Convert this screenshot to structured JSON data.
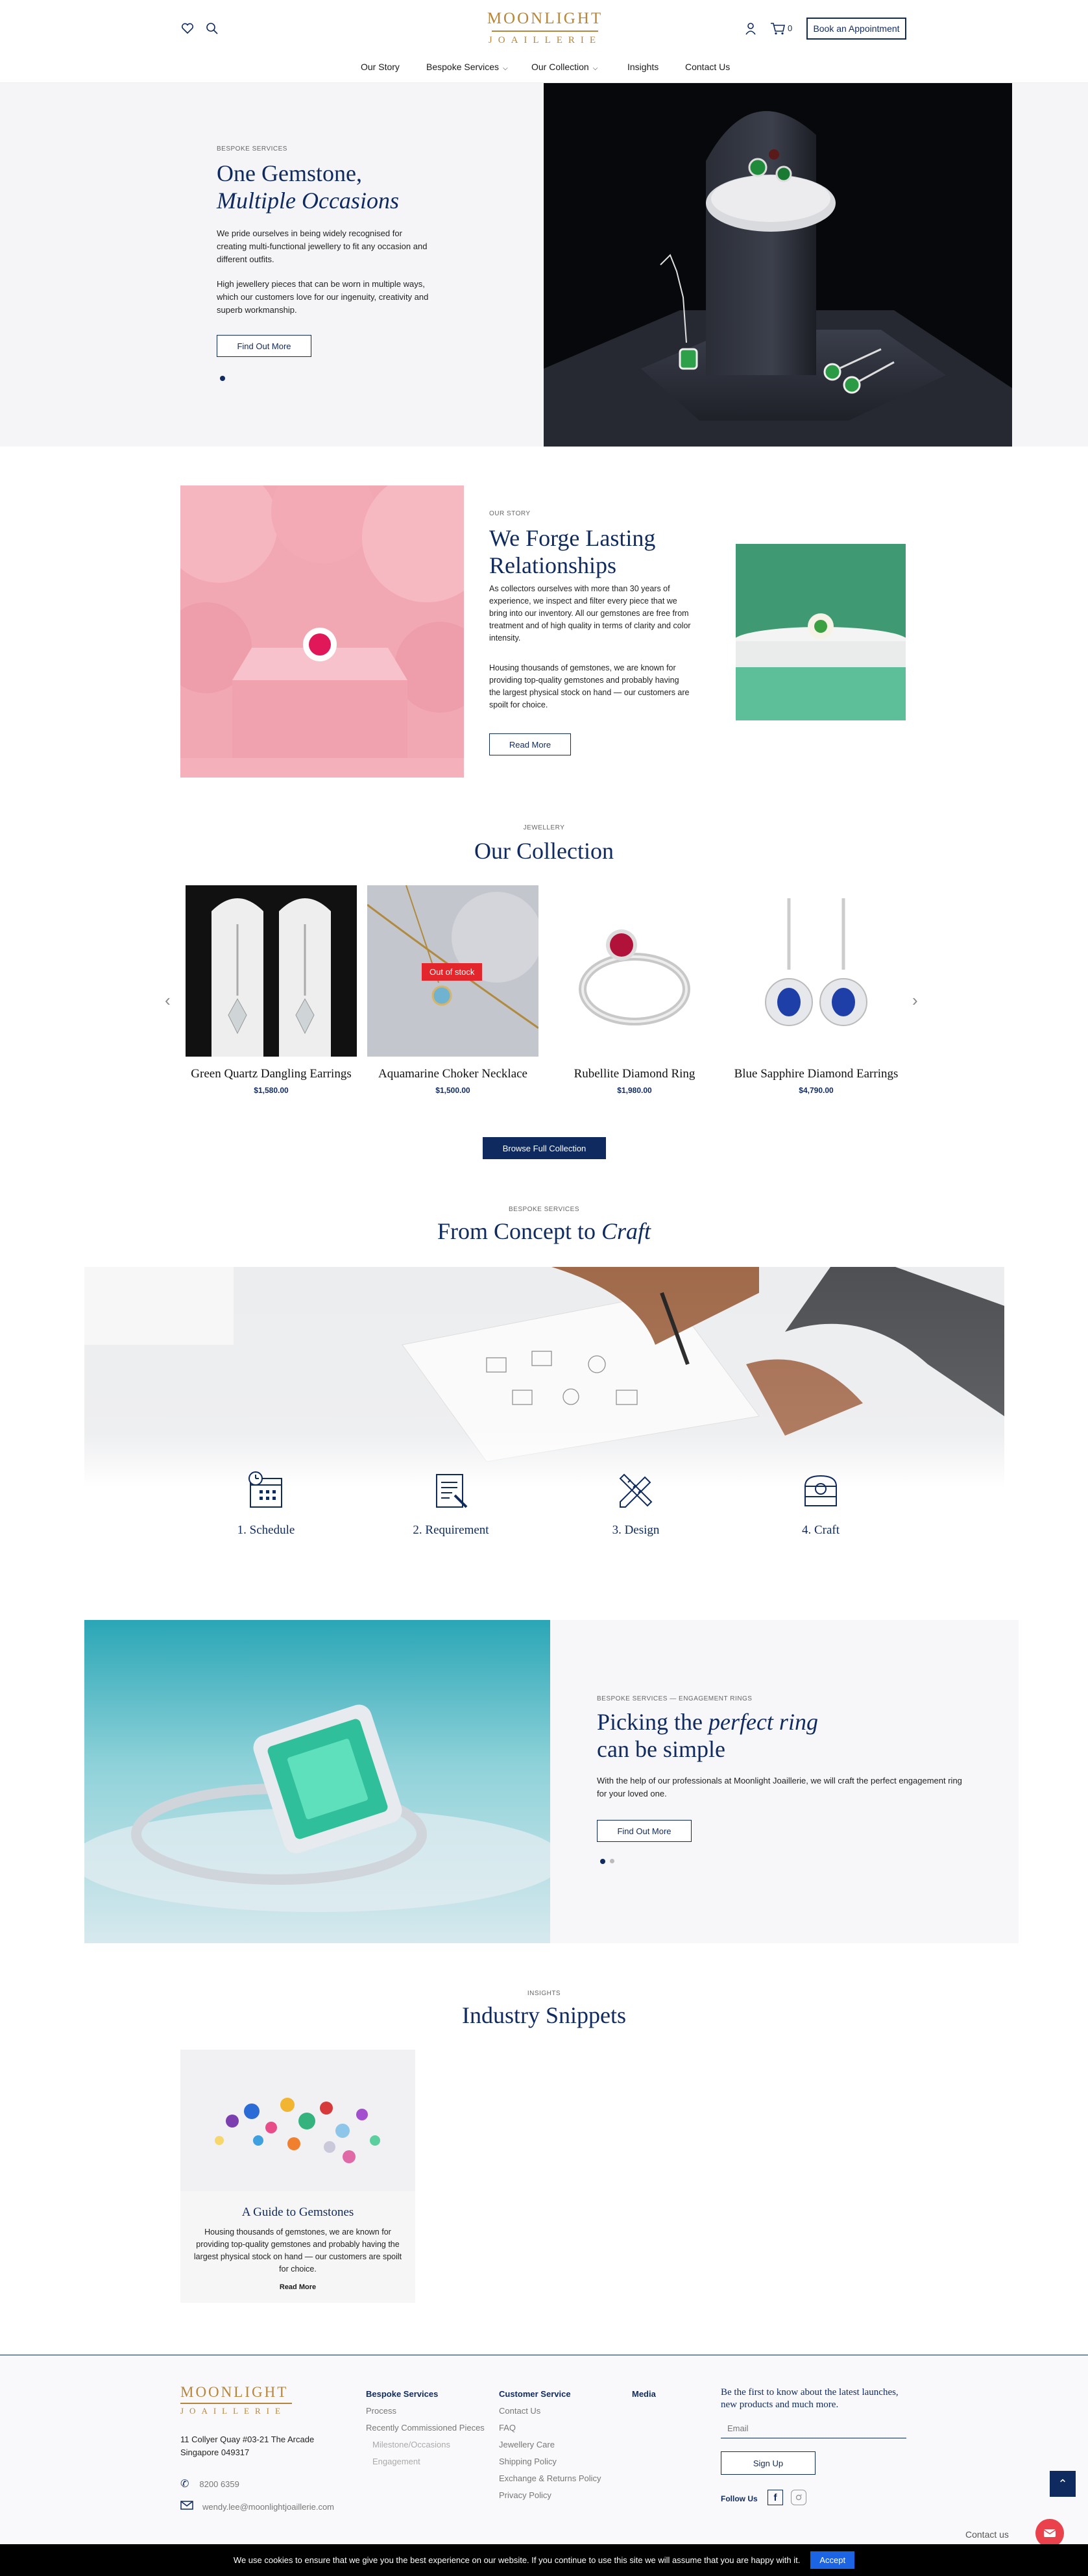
{
  "header": {
    "logo_line1": "MOONLIGHT",
    "logo_line2": "JOAILLERIE",
    "cart_count": "0",
    "appointment_label": "Book an Appointment",
    "icons": [
      "heart-icon",
      "search-icon",
      "user-icon",
      "cart-icon"
    ]
  },
  "nav": [
    {
      "label": "Our Story"
    },
    {
      "label": "Bespoke Services"
    },
    {
      "label": "Our Collection"
    },
    {
      "label": "Insights"
    },
    {
      "label": "Contact Us"
    }
  ],
  "hero": {
    "eyebrow": "BESPOKE SERVICES",
    "title_line1": "One Gemstone,",
    "title_line2": "Multiple Occasions",
    "para1": "We pride ourselves in being widely recognised for creating multi-functional jewellery to fit any occasion and different outfits.",
    "para2": "High jewellery pieces that can be worn in multiple ways, which our customers love for our ingenuity, creativity and superb workmanship.",
    "button": "Find Out More"
  },
  "story": {
    "eyebrow": "OUR STORY",
    "title": "We Forge Lasting Relationships",
    "para1": "As collectors ourselves with more than 30 years of experience, we inspect and filter every piece that we bring into our inventory. All our gemstones are free from treatment and of high quality in terms of clarity and color intensity.",
    "para2": "Housing thousands of gemstones, we are known for providing top-quality gemstones and probably having the largest physical stock on hand — our customers are spoilt for choice.",
    "button": "Read More"
  },
  "collection": {
    "eyebrow": "JEWELLERY",
    "title": "Our Collection",
    "products": [
      {
        "name": "Green Quartz Dangling Earrings",
        "price": "$1,580.00",
        "badge": ""
      },
      {
        "name": "Aquamarine Choker Necklace",
        "price": "$1,500.00",
        "badge": "Out of stock"
      },
      {
        "name": "Rubellite Diamond Ring",
        "price": "$1,980.00",
        "badge": ""
      },
      {
        "name": "Blue Sapphire Diamond Earrings",
        "price": "$4,790.00",
        "badge": ""
      }
    ],
    "browse_button": "Browse Full Collection"
  },
  "concept": {
    "eyebrow": "BESPOKE SERVICES",
    "title_plain": "From Concept to",
    "title_italic": "Craft",
    "steps": [
      {
        "label": "1. Schedule",
        "icon": "calendar-clock-icon"
      },
      {
        "label": "2. Requirement",
        "icon": "clipboard-pen-icon"
      },
      {
        "label": "3. Design",
        "icon": "pencil-ruler-icon"
      },
      {
        "label": "4. Craft",
        "icon": "ring-box-icon"
      }
    ]
  },
  "engagement": {
    "eyebrow": "BESPOKE SERVICES — ENGAGEMENT RINGS",
    "title_plain1": "Picking the",
    "title_italic": "perfect ring",
    "title_plain2": "can be simple",
    "para": "With the help of our professionals at Moonlight Joaillerie, we will craft the perfect engagement ring for your loved one.",
    "button": "Find Out More"
  },
  "insights": {
    "eyebrow": "INSIGHTS",
    "title": "Industry Snippets",
    "article": {
      "title": "A Guide to Gemstones",
      "body": "Housing thousands of gemstones, we are known for providing top-quality gemstones and probably having the largest physical stock on hand — our customers are spoilt for choice.",
      "link": "Read More"
    }
  },
  "footer": {
    "logo_line1": "MOONLIGHT",
    "logo_line2": "JOAILLERIE",
    "address_line1": "11 Collyer Quay #03-21 The Arcade",
    "address_line2": "Singapore 049317",
    "phone": "8200 6359",
    "email": "wendy.lee@moonlightjoaillerie.com",
    "col1_head": "Bespoke Services",
    "col1_links": [
      "Process",
      "Recently Commissioned Pieces"
    ],
    "col1_sublinks": [
      "Milestone/Occasions",
      "Engagement"
    ],
    "col2_head": "Customer Service",
    "col2_links": [
      "Contact Us",
      "FAQ",
      "Jewellery Care",
      "Shipping Policy",
      "Exchange & Returns Policy",
      "Privacy Policy"
    ],
    "col3_head": "Media",
    "newsletter_text": "Be the first to know about the latest launches, new products and much more.",
    "email_placeholder": "Email",
    "signup_button": "Sign Up",
    "follow_label": "Follow Us",
    "contact_widget": "Contact us"
  },
  "cookie": {
    "text": "We use cookies to ensure that we give you the best experience on our website. If you continue to use this site we will assume that you are happy with it.",
    "accept": "Accept"
  },
  "colors": {
    "navy": "#0f2a5f",
    "gold": "#b8863b",
    "oos_red": "#e3262c",
    "accept_blue": "#1b64e4"
  }
}
